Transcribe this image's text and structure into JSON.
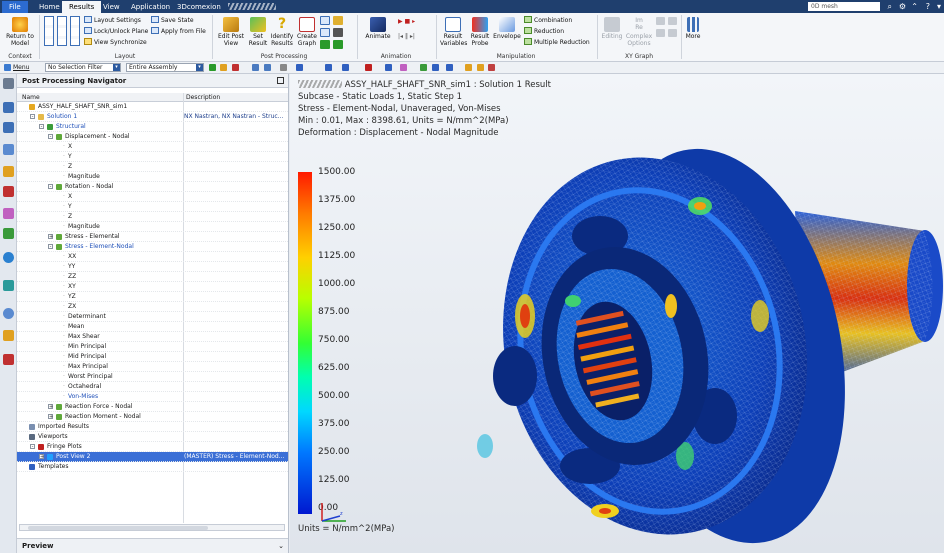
{
  "tabs": {
    "file": "File",
    "home": "Home",
    "results": "Results",
    "view": "View",
    "application": "Application",
    "comexion": "3Dcomexion"
  },
  "search": {
    "value": "0D mesh"
  },
  "ribbon": {
    "return_to_model": "Return to\nModel",
    "layout_settings": "Layout Settings",
    "lock_unlock": "Lock/Unlock Plane",
    "view_synchronize": "View Synchronize",
    "save_state": "Save State",
    "apply_from_file": "Apply from File",
    "edit_post_view": "Edit Post\nView",
    "set_result": "Set\nResult",
    "identify_results": "Identify\nResults",
    "create_graph": "Create\nGraph",
    "animate": "Animate",
    "result_variables": "Result\nVariables",
    "result_probe": "Result\nProbe",
    "envelope": "Envelope",
    "combination": "Combination",
    "reduction": "Reduction",
    "multiple_reduction": "Multiple Reduction",
    "editing": "Editing",
    "complex_options": "Complex\nOptions",
    "more": "More",
    "groups": {
      "context": "Context",
      "layout": "Layout",
      "post_processing": "Post Processing",
      "animation": "Animation",
      "manipulation": "Manipulation",
      "xy_graph": "XY Graph"
    }
  },
  "toolbar": {
    "menu": "Menu",
    "selection_filter": "No Selection Filter",
    "scope": "Entire Assembly"
  },
  "navigator": {
    "title": "Post Processing Navigator",
    "col_name": "Name",
    "col_description": "Description",
    "rows": [
      {
        "label": "ASSY_HALF_SHAFT_SNR_sim1",
        "desc": "",
        "indent": 0,
        "exp": "",
        "icon": "#e5a820",
        "style": "",
        "prefix": "////////// "
      },
      {
        "label": "Solution 1",
        "desc": "NX Nastran, NX Nastran - Struc...",
        "indent": 1,
        "exp": "-",
        "icon": "#e5b94a",
        "style": "blue"
      },
      {
        "label": "Structural",
        "desc": "",
        "indent": 2,
        "exp": "-",
        "icon": "#3a9c3a",
        "style": "blue"
      },
      {
        "label": "Displacement - Nodal",
        "desc": "",
        "indent": 3,
        "exp": "-",
        "icon": "#5fa83a",
        "style": ""
      },
      {
        "label": "X",
        "desc": "",
        "indent": 4,
        "exp": "",
        "icon": "",
        "style": ""
      },
      {
        "label": "Y",
        "desc": "",
        "indent": 4,
        "exp": "",
        "icon": "",
        "style": ""
      },
      {
        "label": "Z",
        "desc": "",
        "indent": 4,
        "exp": "",
        "icon": "",
        "style": ""
      },
      {
        "label": "Magnitude",
        "desc": "",
        "indent": 4,
        "exp": "",
        "icon": "",
        "style": ""
      },
      {
        "label": "Rotation - Nodal",
        "desc": "",
        "indent": 3,
        "exp": "-",
        "icon": "#5fa83a",
        "style": ""
      },
      {
        "label": "X",
        "desc": "",
        "indent": 4,
        "exp": "",
        "icon": "",
        "style": ""
      },
      {
        "label": "Y",
        "desc": "",
        "indent": 4,
        "exp": "",
        "icon": "",
        "style": ""
      },
      {
        "label": "Z",
        "desc": "",
        "indent": 4,
        "exp": "",
        "icon": "",
        "style": ""
      },
      {
        "label": "Magnitude",
        "desc": "",
        "indent": 4,
        "exp": "",
        "icon": "",
        "style": ""
      },
      {
        "label": "Stress - Elemental",
        "desc": "",
        "indent": 3,
        "exp": "+",
        "icon": "#5fa83a",
        "style": ""
      },
      {
        "label": "Stress - Element-Nodal",
        "desc": "",
        "indent": 3,
        "exp": "-",
        "icon": "#5fa83a",
        "style": "blue"
      },
      {
        "label": "XX",
        "desc": "",
        "indent": 4,
        "exp": "",
        "icon": "",
        "style": ""
      },
      {
        "label": "YY",
        "desc": "",
        "indent": 4,
        "exp": "",
        "icon": "",
        "style": ""
      },
      {
        "label": "ZZ",
        "desc": "",
        "indent": 4,
        "exp": "",
        "icon": "",
        "style": ""
      },
      {
        "label": "XY",
        "desc": "",
        "indent": 4,
        "exp": "",
        "icon": "",
        "style": ""
      },
      {
        "label": "YZ",
        "desc": "",
        "indent": 4,
        "exp": "",
        "icon": "",
        "style": ""
      },
      {
        "label": "ZX",
        "desc": "",
        "indent": 4,
        "exp": "",
        "icon": "",
        "style": ""
      },
      {
        "label": "Determinant",
        "desc": "",
        "indent": 4,
        "exp": "",
        "icon": "",
        "style": ""
      },
      {
        "label": "Mean",
        "desc": "",
        "indent": 4,
        "exp": "",
        "icon": "",
        "style": ""
      },
      {
        "label": "Max Shear",
        "desc": "",
        "indent": 4,
        "exp": "",
        "icon": "",
        "style": ""
      },
      {
        "label": "Min Principal",
        "desc": "",
        "indent": 4,
        "exp": "",
        "icon": "",
        "style": ""
      },
      {
        "label": "Mid Principal",
        "desc": "",
        "indent": 4,
        "exp": "",
        "icon": "",
        "style": ""
      },
      {
        "label": "Max Principal",
        "desc": "",
        "indent": 4,
        "exp": "",
        "icon": "",
        "style": ""
      },
      {
        "label": "Worst Principal",
        "desc": "",
        "indent": 4,
        "exp": "",
        "icon": "",
        "style": ""
      },
      {
        "label": "Octahedral",
        "desc": "",
        "indent": 4,
        "exp": "",
        "icon": "",
        "style": ""
      },
      {
        "label": "Von-Mises",
        "desc": "",
        "indent": 4,
        "exp": "",
        "icon": "",
        "style": "blue"
      },
      {
        "label": "Reaction Force - Nodal",
        "desc": "",
        "indent": 3,
        "exp": "+",
        "icon": "#5fa83a",
        "style": ""
      },
      {
        "label": "Reaction Moment - Nodal",
        "desc": "",
        "indent": 3,
        "exp": "+",
        "icon": "#5fa83a",
        "style": ""
      },
      {
        "label": "Imported Results",
        "desc": "",
        "indent": 0,
        "exp": "",
        "icon": "#7a8fb0",
        "style": ""
      },
      {
        "label": "Viewports",
        "desc": "",
        "indent": 0,
        "exp": "",
        "icon": "#5a6a80",
        "style": ""
      },
      {
        "label": "Fringe Plots",
        "desc": "",
        "indent": 1,
        "exp": "-",
        "icon": "#c02020",
        "style": ""
      },
      {
        "label": "Post View 2",
        "desc": "(MASTER) Stress - Element-Nod...",
        "indent": 2,
        "exp": "+",
        "icon": "#20a0ff",
        "style": "sel"
      },
      {
        "label": "Templates",
        "desc": "",
        "indent": 0,
        "exp": "",
        "icon": "#3060c0",
        "style": ""
      }
    ],
    "preview": "Preview"
  },
  "viewport": {
    "title": "ASSY_HALF_SHAFT_SNR_sim1 : Solution 1 Result",
    "subcase": "Subcase - Static Loads 1, Static Step 1",
    "stress": "Stress - Element-Nodal, Unaveraged, Von-Mises",
    "minmax": "Min : 0.01, Max : 8398.61, Units = N/mm^2(MPa)",
    "deformation": "Deformation : Displacement - Nodal Magnitude",
    "legend": [
      "1500.00",
      "1375.00",
      "1250.00",
      "1125.00",
      "1000.00",
      "875.00",
      "750.00",
      "625.00",
      "500.00",
      "375.00",
      "250.00",
      "125.00",
      "0.00"
    ],
    "units": "Units = N/mm^2(MPa)"
  }
}
